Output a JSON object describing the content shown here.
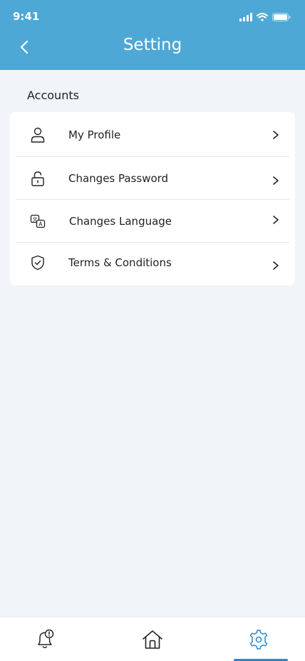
{
  "status_bar": {
    "time": "9:41"
  },
  "header": {
    "title": "Setting",
    "back_icon": "chevron-left-icon"
  },
  "section": {
    "title": "Accounts"
  },
  "settings": [
    {
      "label": "My Profile",
      "icon": "user-icon"
    },
    {
      "label": "Changes Password",
      "icon": "lock-icon"
    },
    {
      "label": "Changes Language",
      "icon": "translate-icon"
    },
    {
      "label": "Terms & Conditions",
      "icon": "shield-check-icon"
    }
  ],
  "bottom_nav": {
    "items": [
      {
        "icon": "bell-alert-icon",
        "active": false
      },
      {
        "icon": "home-icon",
        "active": false
      },
      {
        "icon": "gear-icon",
        "active": true
      }
    ]
  },
  "colors": {
    "header_bg": "#4da8d6",
    "page_bg": "#f1f5f9",
    "active_nav": "#2a88c9"
  }
}
